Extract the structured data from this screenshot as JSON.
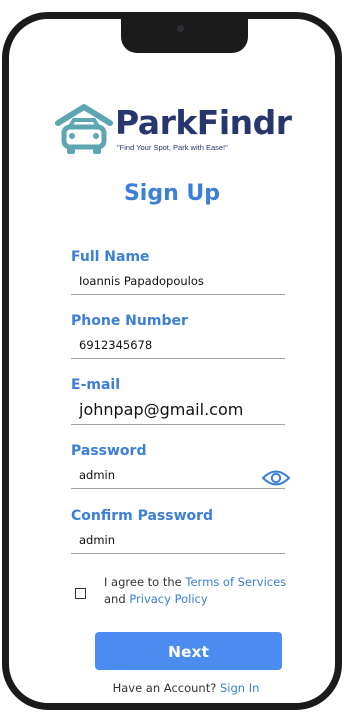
{
  "brand": {
    "name": "ParkFindr",
    "tagline": "\"Find Your Spot, Park with Ease!\"",
    "icon": "parking-car-icon"
  },
  "page_title": "Sign Up",
  "form": {
    "full_name": {
      "label": "Full Name",
      "value": "Ioannis Papadopoulos"
    },
    "phone": {
      "label": "Phone Number",
      "value": "6912345678"
    },
    "email": {
      "label": "E-mail",
      "value": "johnpap@gmail.com"
    },
    "password": {
      "label": "Password",
      "value": "admin",
      "toggle_icon": "eye-icon"
    },
    "confirm_password": {
      "label": "Confirm Password",
      "value": "admin"
    }
  },
  "agreement": {
    "checked": false,
    "prefix": "I agree to the ",
    "terms_link": "Terms of Services",
    "and_text": "and ",
    "privacy_link": "Privacy Policy"
  },
  "next_button": "Next",
  "footer": {
    "prompt": "Have an Account?",
    "signin_link": "Sign In"
  },
  "colors": {
    "accent": "#3b7fd6",
    "button": "#4b8cf0",
    "brand_text": "#27376e",
    "logo_teal": "#5fa6b3"
  }
}
